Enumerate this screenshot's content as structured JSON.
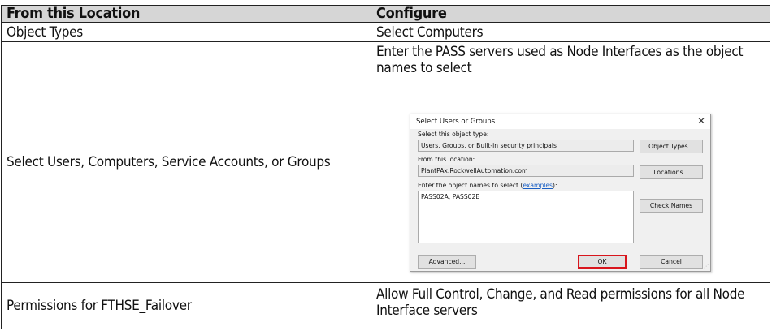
{
  "table": {
    "headers": [
      "From this Location",
      "Configure"
    ],
    "rows": [
      {
        "location": "Object Types",
        "configure": "Select Computers"
      },
      {
        "location": "Select Users, Computers, Service Accounts, or Groups",
        "configure": "Enter the PASS servers used as Node Interfaces as the object names to select"
      },
      {
        "location": "Permissions for FTHSE_Failover",
        "configure": "Allow Full Control, Change, and Read permissions for all Node Interface servers"
      }
    ]
  },
  "dialog": {
    "title": "Select Users or Groups",
    "close_icon": "close-icon",
    "object_type_label": "Select this object type:",
    "object_type_value": "Users, Groups, or Built-in security principals",
    "object_types_button": "Object Types...",
    "location_label": "From this location:",
    "location_value": "PlantPAx.RockwellAutomation.com",
    "locations_button": "Locations...",
    "names_label": "Enter the object names to select (",
    "names_link": "examples",
    "names_label_end": "):",
    "names_value": "PASS02A; PASS02B",
    "check_names_button": "Check Names",
    "advanced_button": "Advanced...",
    "ok_button": "OK",
    "cancel_button": "Cancel",
    "ok_highlight_color": "#d8151c"
  }
}
